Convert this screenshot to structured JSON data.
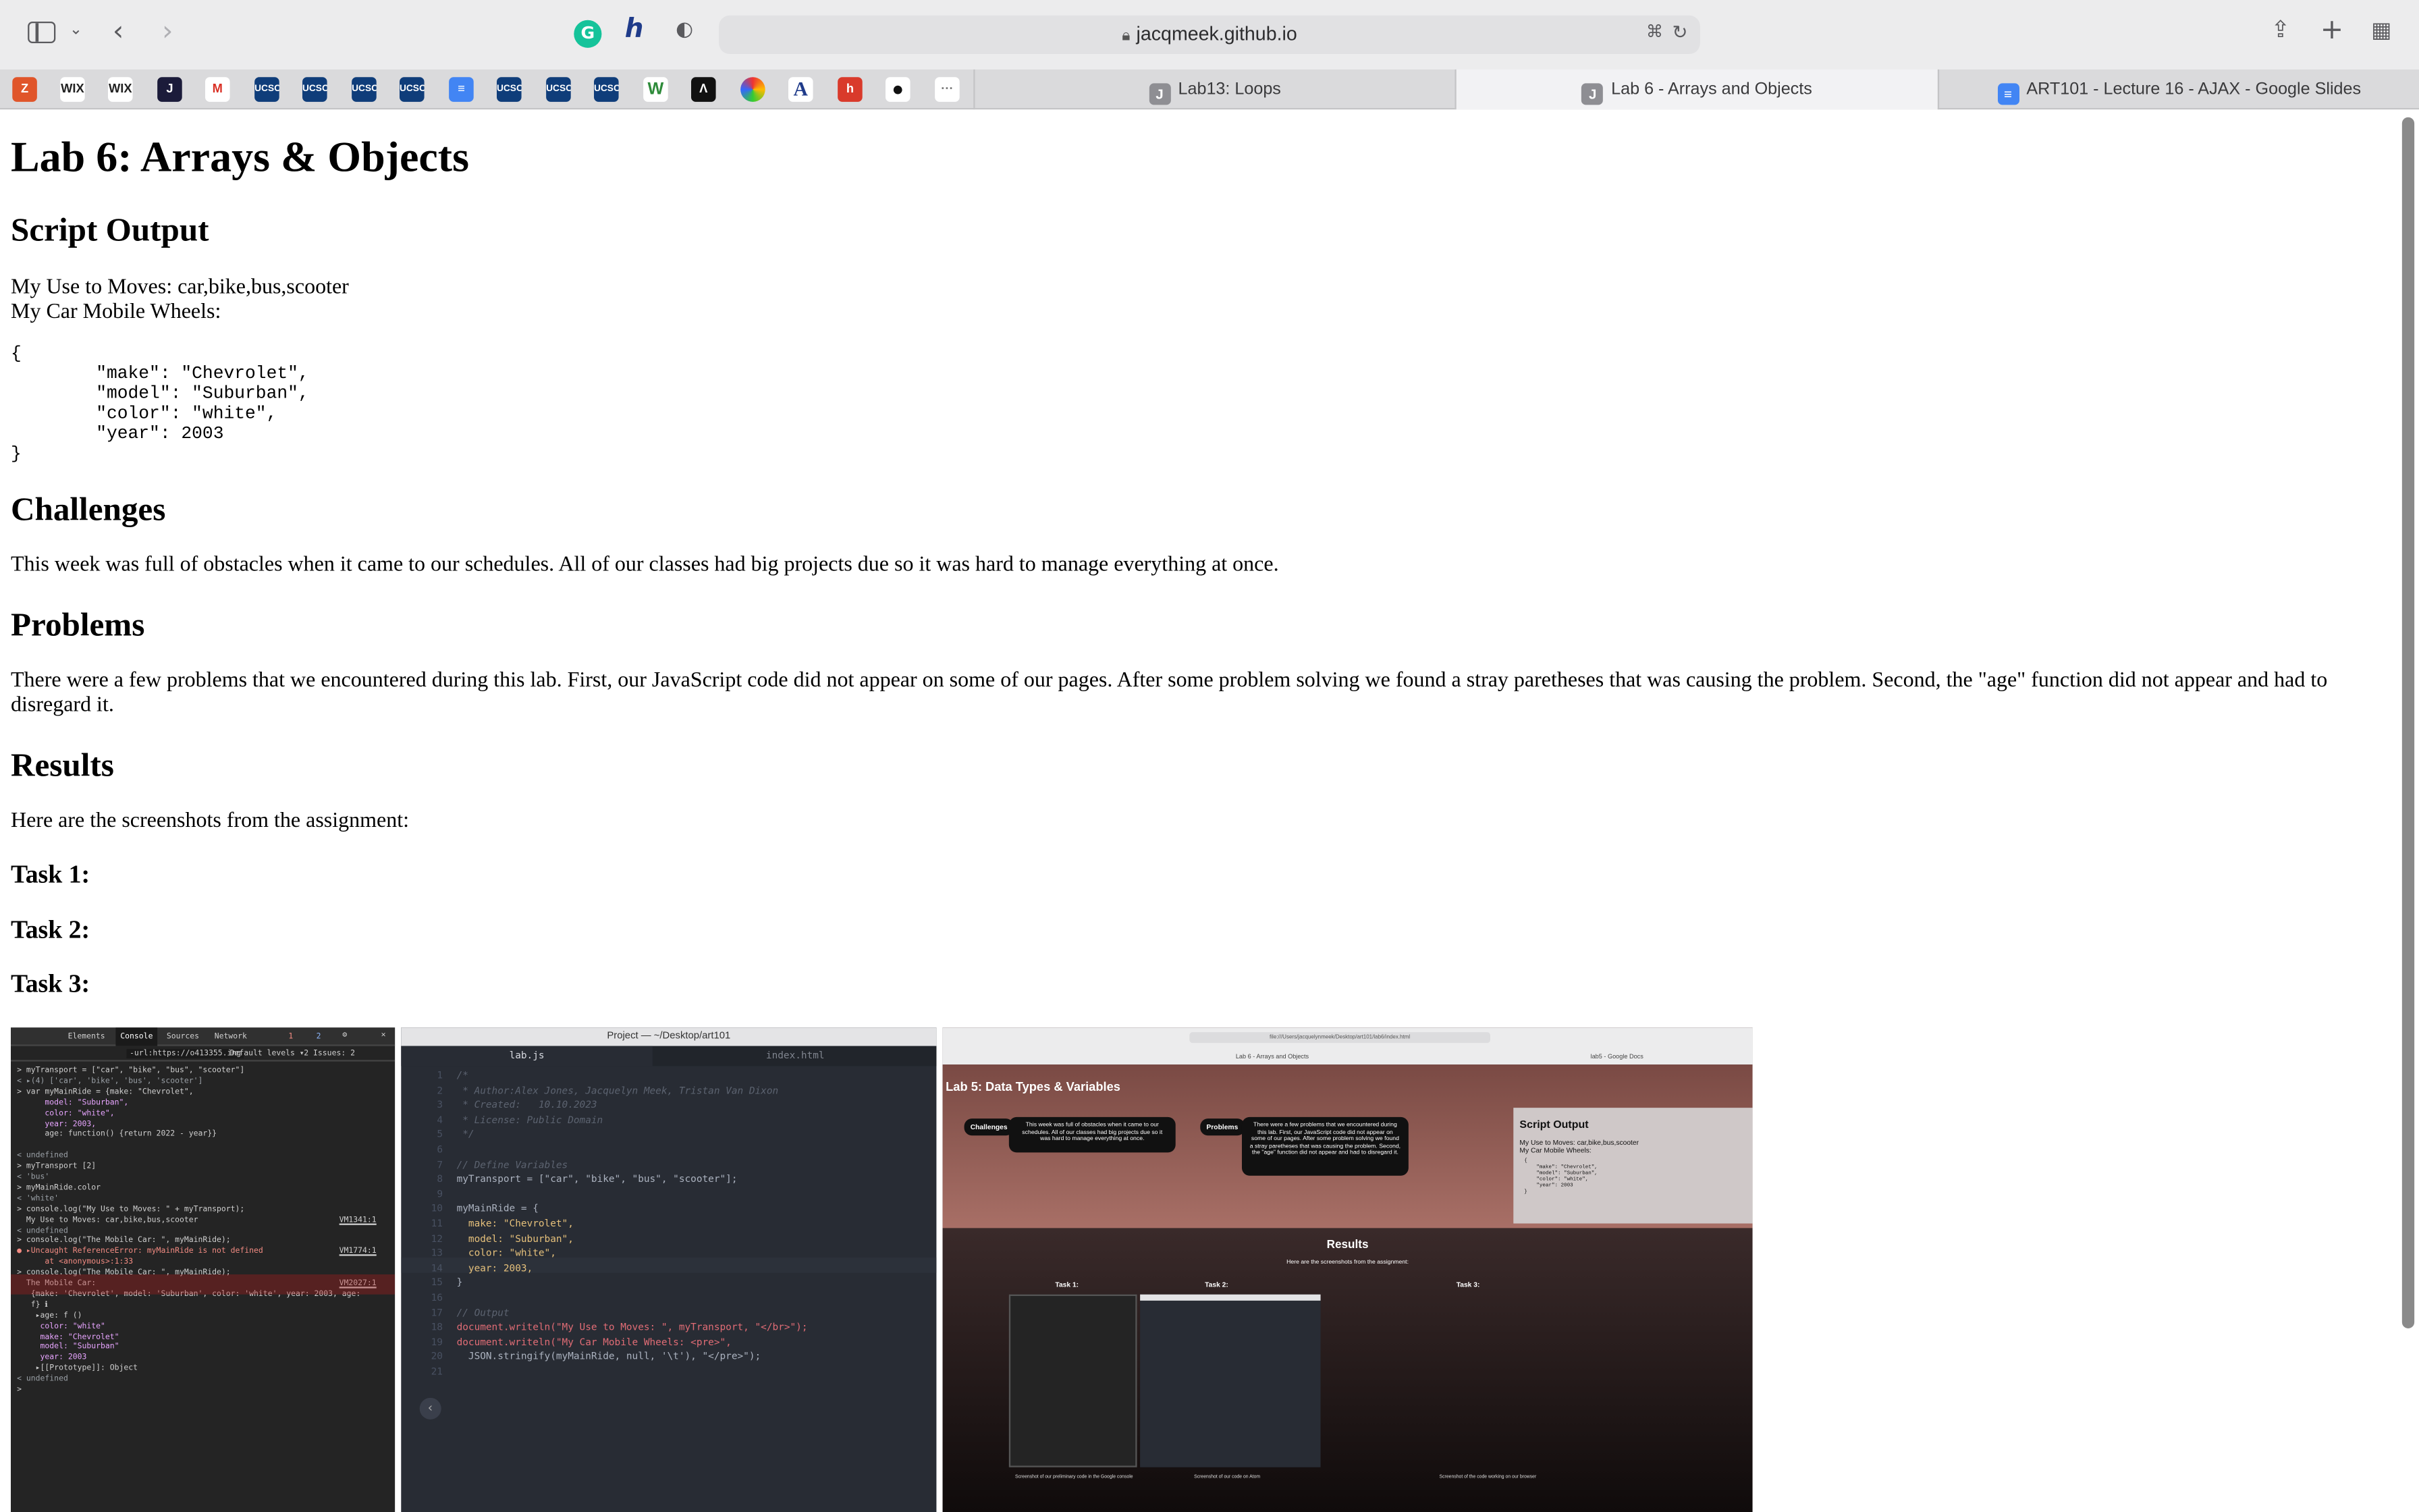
{
  "browser": {
    "url": "jacqmeek.github.io",
    "tabs": [
      {
        "label": "Lab13: Loops",
        "icon": "J",
        "active": false
      },
      {
        "label": "Lab 6 - Arrays and Objects",
        "icon": "J",
        "active": true
      },
      {
        "label": "ART101 - Lecture 16 - AJAX - Google Slides",
        "icon": "slides",
        "active": false
      }
    ],
    "favorites": [
      "Z",
      "WIX",
      "WIX",
      "",
      "M",
      "UCSC",
      "UCSC",
      "UCSC",
      "UCSC",
      "",
      "UCSC",
      "UCSC",
      "UCSC",
      "W",
      "",
      "",
      "A",
      "h",
      "",
      "..."
    ]
  },
  "page": {
    "title": "Lab 6: Arrays & Objects",
    "script_output_heading": "Script Output",
    "output_line1": "My Use to Moves: car,bike,bus,scooter",
    "output_line2": "My Car Mobile Wheels:",
    "json_block": "{\n        \"make\": \"Chevrolet\",\n        \"model\": \"Suburban\",\n        \"color\": \"white\",\n        \"year\": 2003\n}",
    "challenges_heading": "Challenges",
    "challenges_text": "This week was full of obstacles when it came to our schedules. All of our classes had big projects due so it was hard to manage everything at once.",
    "problems_heading": "Problems",
    "problems_text": "There were a few problems that we encountered during this lab. First, our JavaScript code did not appear on some of our pages. After some problem solving we found a stray paretheses that was causing the problem. Second, the \"age\" function did not appear and had to disregard it.",
    "results_heading": "Results",
    "results_text": "Here are the screenshots from the assignment:",
    "task1": "Task 1:",
    "task2": "Task 2:",
    "task3": "Task 3:"
  },
  "devtools": {
    "tabs": [
      "Elements",
      "Console",
      "Sources",
      "Network"
    ],
    "active_tab": "Console",
    "filter_placeholder": "-url:https://o413355.ing",
    "levels": "Default levels ▾",
    "issues": "2 Issues: 2",
    "error_count": "1",
    "warn_count": "2",
    "lines": [
      "> myTransport = [\"car\", \"bike\", \"bus\", \"scooter\"]",
      "< ▸(4) ['car', 'bike', 'bus', 'scooter']",
      "> var myMainRide = {make: \"Chevrolet\",",
      "      model: \"Suburban\",",
      "      color: \"white\",",
      "      year: 2003,",
      "      age: function() {return 2022 - year}}",
      "",
      "< undefined",
      "> myTransport [2]",
      "< 'bus'",
      "> myMainRide.color",
      "< 'white'",
      "> console.log(\"My Use to Moves: \" + myTransport);",
      "  My Use to Moves: car,bike,bus,scooter",
      "< undefined",
      "> console.log(\"The Mobile Car: \", myMainRide);",
      "● ▸Uncaught ReferenceError: myMainRide is not defined",
      "      at <anonymous>:1:33",
      "> console.log(\"The Mobile Car: \", myMainRide);",
      "  The Mobile Car:",
      "   {make: 'Chevrolet', model: 'Suburban', color: 'white', year: 2003, age:",
      "   f} ℹ",
      "    ▸age: f ()",
      "     color: \"white\"",
      "     make: \"Chevrolet\"",
      "     model: \"Suburban\"",
      "     year: 2003",
      "    ▸[[Prototype]]: Object",
      "< undefined",
      ">"
    ],
    "links": [
      "VM1341:1",
      "VM1774:1",
      "VM2027:1"
    ]
  },
  "editor": {
    "window_title": "Project — ~/Desktop/art101",
    "tabs": [
      "lab.js",
      "index.html"
    ],
    "active_tab": "lab.js",
    "lines": [
      "/*",
      " * Author:Alex Jones, Jacquelyn Meek, Tristan Van Dixon",
      " * Created:   10.10.2023",
      " * License: Public Domain",
      " */",
      "",
      "// Define Variables",
      "myTransport = [\"car\", \"bike\", \"bus\", \"scooter\"];",
      "",
      "myMainRide = {",
      "  make: \"Chevrolet\",",
      "  model: \"Suburban\",",
      "  color: \"white\",",
      "  year: 2003,",
      "}",
      "",
      "// Output",
      "document.writeln(\"My Use to Moves: \", myTransport, \"</br>\");",
      "document.writeln(\"My Car Mobile Wheels: <pre>\",",
      "  JSON.stringify(myMainRide, null, '\\t'), \"</pre>\");",
      ""
    ]
  },
  "preview": {
    "url": "file:///Users/jacquelynmeek/Desktop/art101/lab6/index.html",
    "tabs": [
      "Lab 6 - Arrays and Objects",
      "lab5 - Google Docs"
    ],
    "title": "Lab 5: Data Types & Variables",
    "challenges_label": "Challenges",
    "challenges_text": "This week was full of obstacles when it came to our schedules. All of our classes had big projects due so it was hard to manage everything at once.",
    "problems_label": "Problems",
    "problems_text": "There were a few problems that we encountered during this lab. First, our JavaScript code did not appear on some of our pages. After some problem solving we found a stray paretheses that was causing the problem. Second, the \"age\" function did not appear and had to disregard it.",
    "script_output": "Script Output",
    "out1": "My Use to Moves: car,bike,bus,scooter",
    "out2": "My Car Mobile Wheels:",
    "json": "{\n    \"make\": \"Chevrolet\",\n    \"model\": \"Suburban\",\n    \"color\": \"white\",\n    \"year\": 2003\n}",
    "results": "Results",
    "results_text": "Here are the screenshots from the assignment:",
    "task1": "Task 1:",
    "task2": "Task 2:",
    "task3": "Task 3:",
    "cap1": "Screenshot of our preliminary code in the Google console",
    "cap2": "Screenshot of our code on Atom",
    "cap3": "Screenshot of the code working on our browser"
  }
}
